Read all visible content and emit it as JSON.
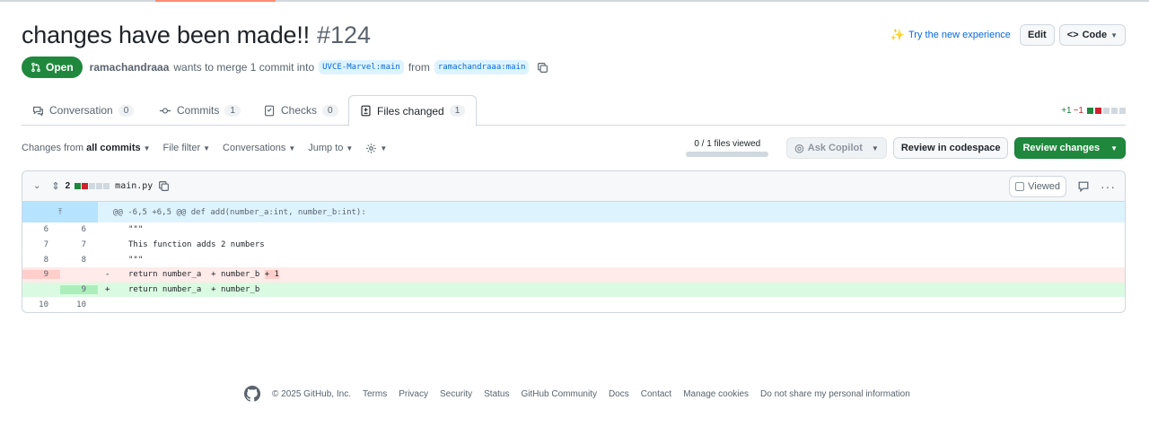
{
  "pr": {
    "title": "changes have been made!!",
    "number": "#124",
    "state": "Open",
    "author": "ramachandraaa",
    "merge_text": "wants to merge 1 commit into",
    "base_branch": "UVCE-Marvel:main",
    "from_text": "from",
    "head_branch": "ramachandraaa:main"
  },
  "header_actions": {
    "try_new": "Try the new experience",
    "edit": "Edit",
    "code": "Code"
  },
  "tabs": [
    {
      "label": "Conversation",
      "count": "0"
    },
    {
      "label": "Commits",
      "count": "1"
    },
    {
      "label": "Checks",
      "count": "0"
    },
    {
      "label": "Files changed",
      "count": "1"
    }
  ],
  "diffstat": {
    "additions": "+1",
    "deletions": "−1"
  },
  "toolbar": {
    "changes_from_prefix": "Changes from",
    "changes_from_value": "all commits",
    "file_filter": "File filter",
    "conversations": "Conversations",
    "jump_to": "Jump to",
    "files_viewed": "0 / 1 files viewed",
    "ask_copilot": "Ask Copilot",
    "review_in_codespace": "Review in codespace",
    "review_changes": "Review changes"
  },
  "file": {
    "changes": "2",
    "name": "main.py",
    "viewed_label": "Viewed",
    "hunk_header": "@@ -6,5 +6,5 @@ def add(number_a:int, number_b:int):",
    "lines": [
      {
        "old": "6",
        "new": "6",
        "marker": "",
        "code": "\"\"\""
      },
      {
        "old": "7",
        "new": "7",
        "marker": "",
        "code": "This function adds 2 numbers"
      },
      {
        "old": "8",
        "new": "8",
        "marker": "",
        "code": "\"\"\""
      },
      {
        "old": "9",
        "new": "",
        "marker": "-",
        "code": "return number_a  + number_b ",
        "code_hl": "+ 1"
      },
      {
        "old": "",
        "new": "9",
        "marker": "+",
        "code": "return number_a  + number_b"
      },
      {
        "old": "10",
        "new": "10",
        "marker": "",
        "code": ""
      }
    ]
  },
  "footer": {
    "copyright": "© 2025 GitHub, Inc.",
    "links": [
      "Terms",
      "Privacy",
      "Security",
      "Status",
      "GitHub Community",
      "Docs",
      "Contact",
      "Manage cookies",
      "Do not share my personal information"
    ]
  }
}
